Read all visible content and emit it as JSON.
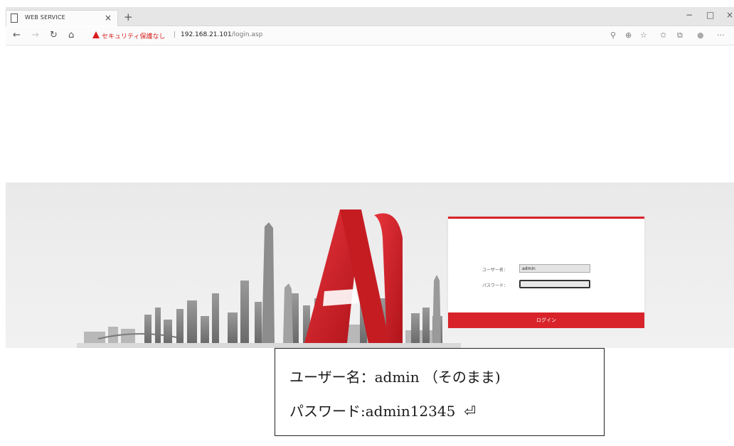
{
  "browser": {
    "tab_title": "WEB SERVICE",
    "tab_close": "×",
    "new_tab": "+",
    "window_controls": {
      "minimize": "−",
      "maximize": "□",
      "close": "×"
    },
    "nav": {
      "back": "←",
      "forward": "→",
      "refresh": "↻",
      "home": "⌂"
    },
    "security_label": "セキュリティ保護なし",
    "separator": "|",
    "url_host": "192.168.21.101",
    "url_path": "/login.asp",
    "toolbar_icons": {
      "search": "⚲",
      "zoom": "⊕",
      "favorite": "☆",
      "favorites_bar": "✩",
      "collections": "⧉",
      "profile": "●",
      "more": "···"
    }
  },
  "logo": {
    "text": "AI"
  },
  "login": {
    "username_label": "ユーザー名：",
    "username_value": "admin",
    "password_label": "パスワード：",
    "password_value": "",
    "submit_label": "ログイン"
  },
  "note": {
    "line1": "ユーザー名：admin （そのまま)",
    "line2": "パスワード:admin12345",
    "return_symbol": "⏎"
  },
  "colors": {
    "accent": "#d8232a",
    "banner": "#ececec"
  }
}
